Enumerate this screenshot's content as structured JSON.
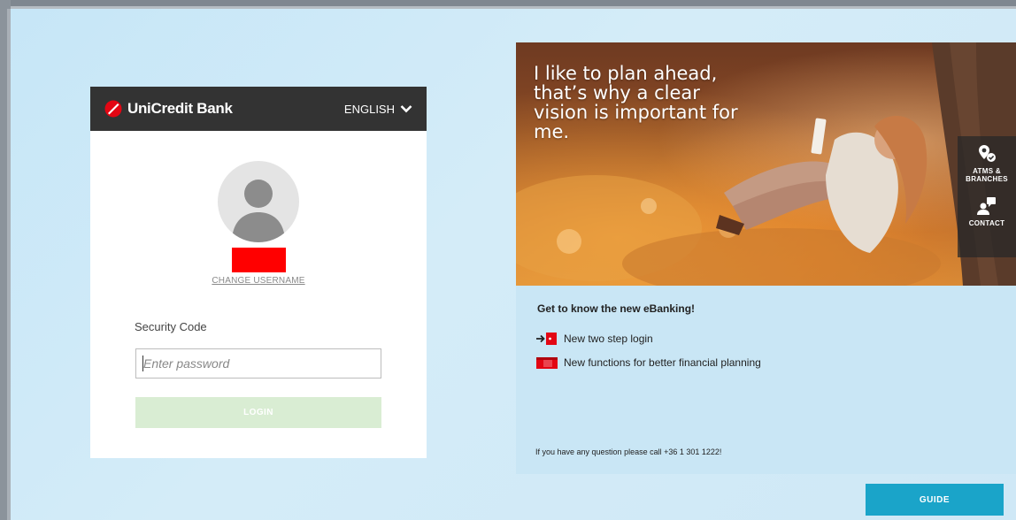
{
  "login": {
    "brand": "UniCredit Bank",
    "language": "ENGLISH",
    "change_username": "CHANGE USERNAME",
    "security_code_label": "Security Code",
    "password_placeholder": "Enter password",
    "login_label": "LOGIN"
  },
  "promo": {
    "hero_text": "I like to plan ahead, that’s why a clear vision is important for me.",
    "tools": [
      {
        "label": "ATMS & BRANCHES",
        "icon": "map-pin-icon"
      },
      {
        "label": "CONTACT",
        "icon": "contact-icon"
      }
    ],
    "title": "Get to know the new eBanking!",
    "features": [
      {
        "text": "New two step login",
        "icon": "two-step-login-icon"
      },
      {
        "text": "New functions for better financial planning",
        "icon": "financial-planning-icon"
      }
    ],
    "question": "If you have any question please call +36 1 301 1222!"
  },
  "guide_label": "GUIDE",
  "colors": {
    "brand_red": "#e30613",
    "header_dark": "#333333",
    "login_button": "#d9edd3",
    "guide_button": "#1aa4c9",
    "background": "#c6e6f7"
  }
}
